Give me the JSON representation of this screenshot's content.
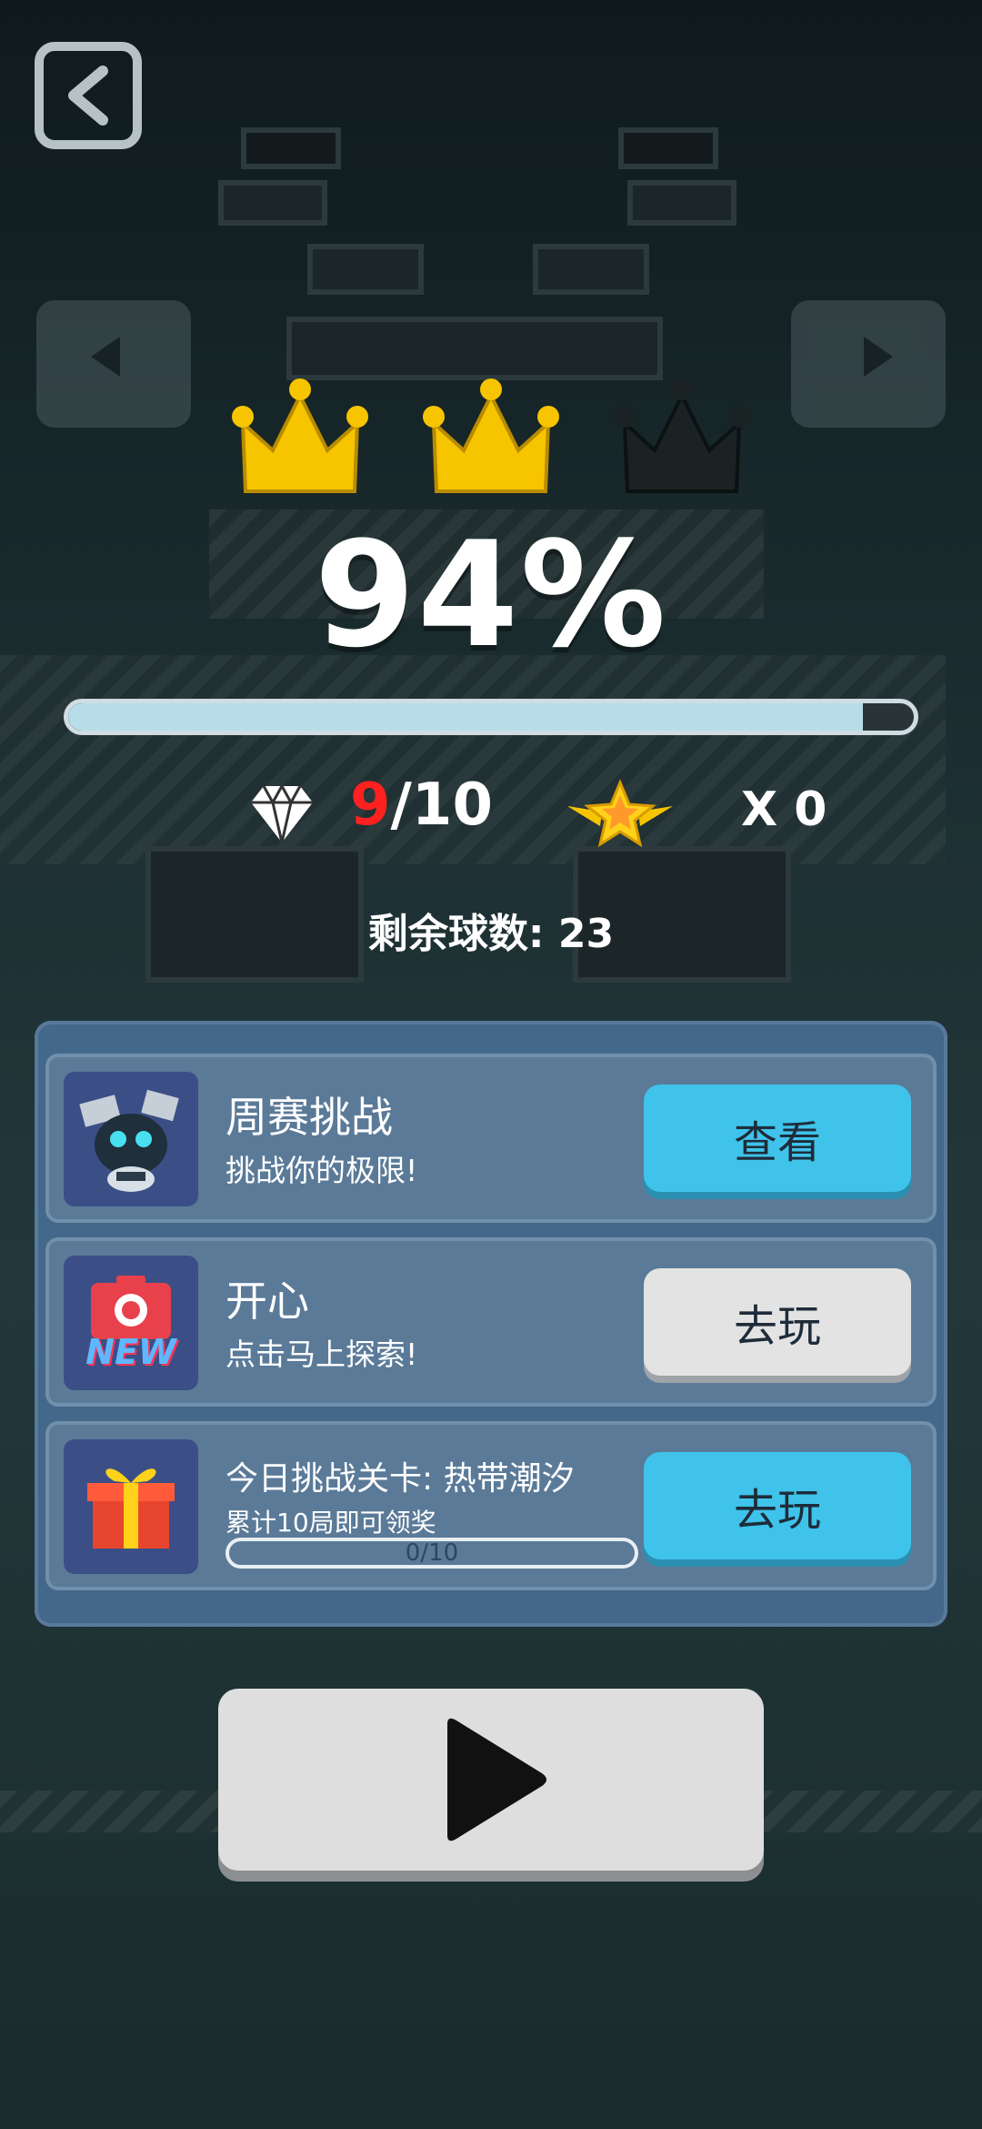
{
  "result": {
    "crowns_earned": 2,
    "crowns_total": 3,
    "percent_label": "94%",
    "progress": 0.94
  },
  "stats": {
    "gems_collected": "9",
    "gems_total_label": "/10",
    "stars_label": "X 0"
  },
  "balls_remaining_label": "剩余球数: 23",
  "cards": [
    {
      "title": "周赛挑战",
      "subtitle": "挑战你的极限!",
      "button": "查看",
      "button_style": "blue",
      "icon": "robot-icon"
    },
    {
      "title": "开心",
      "subtitle": "点击马上探索!",
      "button": "去玩",
      "button_style": "gray",
      "icon": "new-camera-icon",
      "icon_badge": "NEW"
    },
    {
      "title": "今日挑战关卡: 热带潮汐",
      "subtitle": "累计10局即可领奖",
      "button": "去玩",
      "button_style": "blue",
      "icon": "gift-icon",
      "progress_label": "0/10",
      "progress": 0
    }
  ],
  "colors": {
    "crown_gold": "#f7c400",
    "crown_inactive": "#1a2224",
    "progress_fill": "#b7dde8",
    "gem_red": "#ff2020",
    "button_blue": "#3fc3ea",
    "button_gray": "#e3e3e3",
    "panel": "#44688a"
  }
}
